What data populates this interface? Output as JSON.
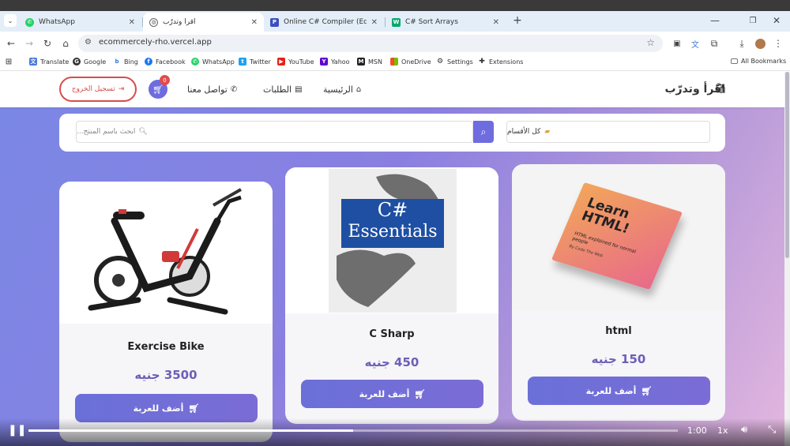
{
  "browser": {
    "tabs": [
      {
        "title": "WhatsApp",
        "icon": "whatsapp-icon",
        "active": false
      },
      {
        "title": "اقرأ وتدرّب",
        "icon": "globe-icon",
        "active": true
      },
      {
        "title": "Online C# Compiler (Editor) - F",
        "icon": "programiz-icon",
        "active": false
      },
      {
        "title": "C# Sort Arrays",
        "icon": "w3schools-icon",
        "active": false
      }
    ],
    "url": "ecommercely-rho.vercel.app",
    "bookmarks": [
      {
        "label": "Translate",
        "icon": "translate-icon"
      },
      {
        "label": "Google",
        "icon": "google-icon"
      },
      {
        "label": "Bing",
        "icon": "bing-icon"
      },
      {
        "label": "Facebook",
        "icon": "facebook-icon"
      },
      {
        "label": "WhatsApp",
        "icon": "whatsapp-icon"
      },
      {
        "label": "Twitter",
        "icon": "twitter-icon"
      },
      {
        "label": "YouTube",
        "icon": "youtube-icon"
      },
      {
        "label": "Yahoo",
        "icon": "yahoo-icon"
      },
      {
        "label": "MSN",
        "icon": "msn-icon"
      },
      {
        "label": "OneDrive",
        "icon": "onedrive-icon"
      },
      {
        "label": "Settings",
        "icon": "gear-icon"
      },
      {
        "label": "Extensions",
        "icon": "puzzle-icon"
      }
    ],
    "all_bookmarks": "All Bookmarks"
  },
  "site": {
    "brand": "اقرأ وتدرّب",
    "nav": {
      "home": "الرئيسية",
      "orders": "الطلبات",
      "contact": "تواصل معنا"
    },
    "cart_count": "0",
    "logout": "تسجيل الخروج",
    "search_placeholder": "ابحث باسم المنتج...",
    "category": "كل الأقسام",
    "products": [
      {
        "name": "Exercise Bike",
        "price": "3500 جنيه",
        "add_label": "أضف للعربة"
      },
      {
        "name": "C Sharp",
        "price": "450 جنيه",
        "add_label": "أضف للعربة"
      },
      {
        "name": "html",
        "price": "150 جنيه",
        "add_label": "أضف للعربة"
      }
    ],
    "book_cover_csharp": {
      "line1": "C#",
      "line2": "Essentials"
    },
    "book_cover_html": {
      "line1": "Learn",
      "line2": "HTML!",
      "line3": "HTML explained for normal people",
      "line4": "By Code The Web"
    }
  },
  "video": {
    "time": "1:00",
    "speed": "1x",
    "progress": 0.5
  },
  "colors": {
    "accent": "#6f6ce0",
    "danger": "#d74d4d",
    "price": "#6b5fb8"
  }
}
